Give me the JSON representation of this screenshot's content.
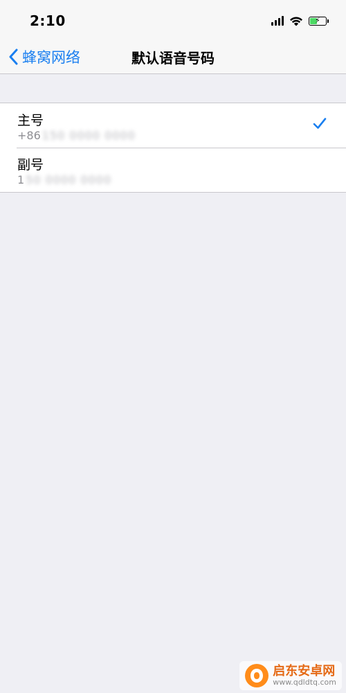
{
  "status_bar": {
    "time": "2:10",
    "icons": [
      "cellular-signal-icon",
      "wifi-icon",
      "battery-charging-icon"
    ],
    "battery_color": "#4cd964"
  },
  "nav": {
    "back_label": "蜂窝网络",
    "title": "默认语音号码",
    "accent_color": "#1a7ff0"
  },
  "lines": [
    {
      "title": "主号",
      "number_prefix": "+86",
      "number_masked": "150 0000 0000",
      "selected": true
    },
    {
      "title": "副号",
      "number_prefix": "1",
      "number_masked": "50 0000 0000",
      "selected": false
    }
  ],
  "watermark": {
    "name": "启东安卓网",
    "url": "www.qdldtq.com"
  }
}
